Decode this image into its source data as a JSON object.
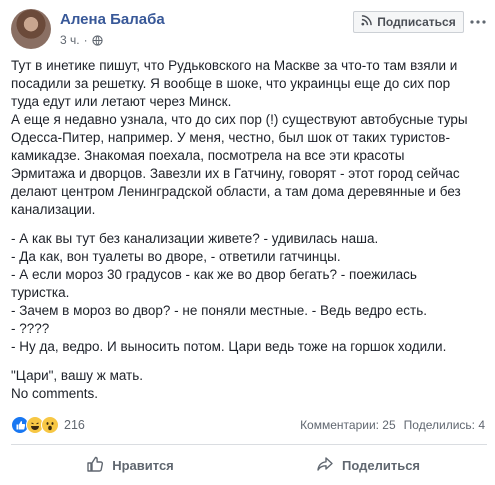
{
  "post": {
    "author": "Алена Балаба",
    "time": "3 ч.",
    "subscribe_label": "Подписаться",
    "paragraphs": [
      [
        "Тут в инетике пишут, что Рудьковского на Маскве за что-то там взяли и",
        "посадили за решетку. Я вообще в шоке, что украинцы еще до сих пор",
        "туда едут или летают через Минск."
      ],
      [
        "А еще я недавно узнала, что до сих пор (!) существуют автобусные туры",
        "Одесса-Питер, например. У меня, честно, был шок от таких туристов-",
        "камикадзе. Знакомая поехала, посмотрела на все эти красоты",
        "Эрмитажа и дворцов. Завезли их в Гатчину, говорят - этот город сейчас",
        "делают центром Ленинградской области, а там дома деревянные и без",
        "канализации."
      ],
      [
        "- А как вы тут без канализации живете? - удивилась наша.",
        "- Да как, вон туалеты во дворе, - ответили гатчинцы.",
        "- А если мороз 30 градусов - как же во двор бегать? - поежилась",
        "туристка."
      ],
      [
        "- Зачем в мороз во двор? - не поняли местные. - Ведь ведро есть."
      ],
      [
        "- ????"
      ],
      [
        "- Ну да, ведро. И выносить потом. Цари ведь тоже на горшок ходили."
      ],
      [
        "\"Цари\", вашу ж мать.",
        "No comments."
      ]
    ],
    "reactions_count": "216",
    "comments": "Комментарии: 25",
    "shares": "Поделились: 4",
    "like_label": "Нравится",
    "share_label": "Поделиться"
  },
  "icons": {
    "time_privacy": "globe-icon",
    "subscribe": "rss-icon",
    "more": "more-options-icon",
    "reactions": [
      "like-reaction-icon",
      "haha-reaction-icon",
      "wow-reaction-icon"
    ],
    "like": "thumbs-up-icon",
    "share": "share-arrow-icon"
  },
  "colors": {
    "author": "#385898",
    "text": "#1d2129",
    "secondary": "#606770",
    "like_reaction": "#1877f2",
    "emoji_yellow": "#f7c744"
  }
}
